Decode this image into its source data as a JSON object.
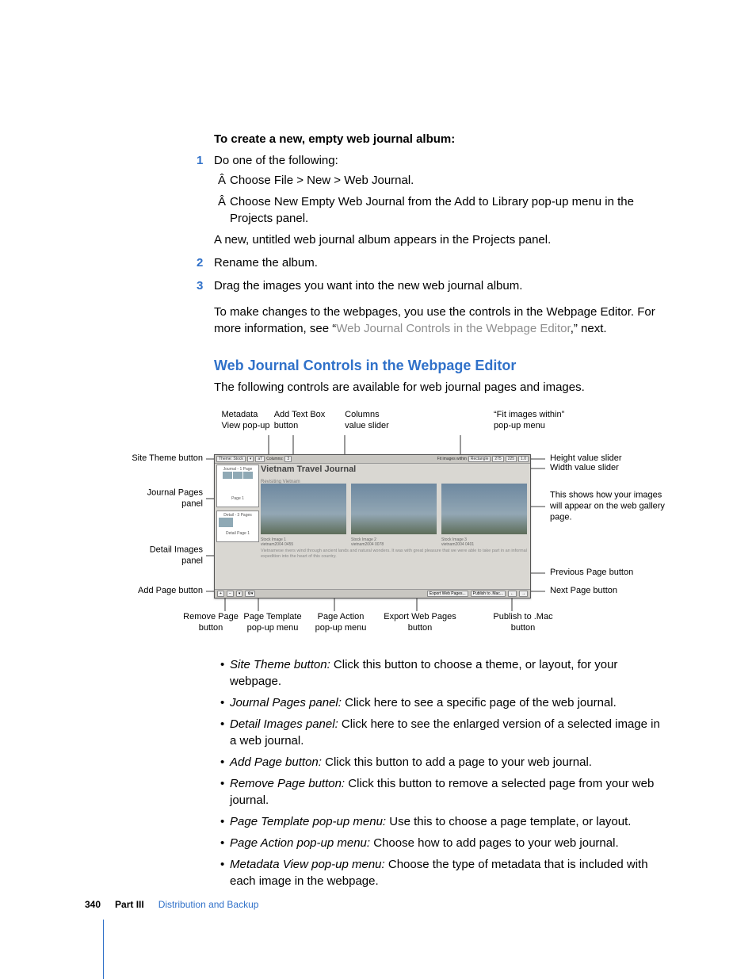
{
  "procedure": {
    "title": "To create a new, empty web journal album:",
    "steps": [
      {
        "text": "Do one of the following:",
        "bullets": [
          "Choose File > New > Web Journal.",
          "Choose New Empty Web Journal from the Add to Library pop-up menu in the Projects panel."
        ],
        "result": "A new, untitled web journal album appears in the Projects panel."
      },
      {
        "text": "Rename the album."
      },
      {
        "text": "Drag the images you want into the new web journal album.",
        "follow": "To make changes to the webpages, you use the controls in the Webpage Editor. For more information, see “",
        "xref": "Web Journal Controls in the Webpage Editor",
        "follow2": ",” next."
      }
    ]
  },
  "section": {
    "heading": "Web Journal Controls in the Webpage Editor",
    "intro": "The following controls are available for web journal pages and images."
  },
  "figure": {
    "toolbar": {
      "theme_btn": "Theme: Stock",
      "columns_lbl": "Columns:",
      "columns_val": "3",
      "fit_lbl": "Fit images within",
      "fit_shape": "Rectangle",
      "width_val": "275",
      "height_val": "225",
      "scale": "1.0"
    },
    "title": "Vietnam Travel Journal",
    "subtitle": "Revisiting Vietnam",
    "journal_panel": "Journal - 1 Page",
    "journal_page_lbl": "Page 1",
    "detail_panel": "Detail - 3 Pages",
    "detail_page_lbl": "Detail Page 1",
    "captions": [
      {
        "t": "Stock Image 1",
        "c": "vietnam2004 0455"
      },
      {
        "t": "Stock Image 2",
        "c": "vietnam2004 0078"
      },
      {
        "t": "Stock Image 3",
        "c": "vietnam2004 0401"
      }
    ],
    "body_text": "Vietnamese rivers wind through ancient lands and natural wonders. It was with great pleasure that we were able to take part in an informal expedition into the heart of this country.",
    "foot": {
      "add": "+",
      "remove": "−",
      "template": "▾",
      "action": "⚙▾",
      "export": "Export Web Pages...",
      "publish": "Publish to .Mac...",
      "prev": "←",
      "next": "→"
    },
    "callouts": {
      "top": [
        "Metadata\nView pop-up",
        "Add Text Box\nbutton",
        "Columns\nvalue slider",
        "“Fit images within”\npop-up menu"
      ],
      "left": [
        "Site Theme button",
        "Journal Pages panel",
        "Detail Images panel",
        "Add Page button"
      ],
      "right": [
        "Height value slider",
        "Width value slider",
        "This shows how your images will appear on the web gallery page.",
        "Previous Page button",
        "Next Page button"
      ],
      "bottom": [
        "Remove Page\nbutton",
        "Page Template\npop-up menu",
        "Page Action\npop-up menu",
        "Export Web Pages\nbutton",
        "Publish to .Mac\nbutton"
      ]
    }
  },
  "glossary": [
    {
      "term": "Site Theme button:",
      "def": "  Click this button to choose a theme, or layout, for your webpage."
    },
    {
      "term": "Journal Pages panel:",
      "def": "  Click here to see a specific page of the web journal."
    },
    {
      "term": "Detail Images panel:",
      "def": "  Click here to see the enlarged version of a selected image in a web journal."
    },
    {
      "term": "Add Page button:",
      "def": "  Click this button to add a page to your web journal."
    },
    {
      "term": "Remove Page button:",
      "def": "  Click this button to remove a selected page from your web journal."
    },
    {
      "term": "Page Template pop-up menu:",
      "def": "  Use this to choose a page template, or layout."
    },
    {
      "term": "Page Action pop-up menu:",
      "def": "  Choose how to add pages to your web journal."
    },
    {
      "term": "Metadata View pop-up menu:",
      "def": "  Choose the type of metadata that is included with each image in the webpage."
    }
  ],
  "footer": {
    "page": "340",
    "part": "Part III",
    "section": "Distribution and Backup"
  }
}
